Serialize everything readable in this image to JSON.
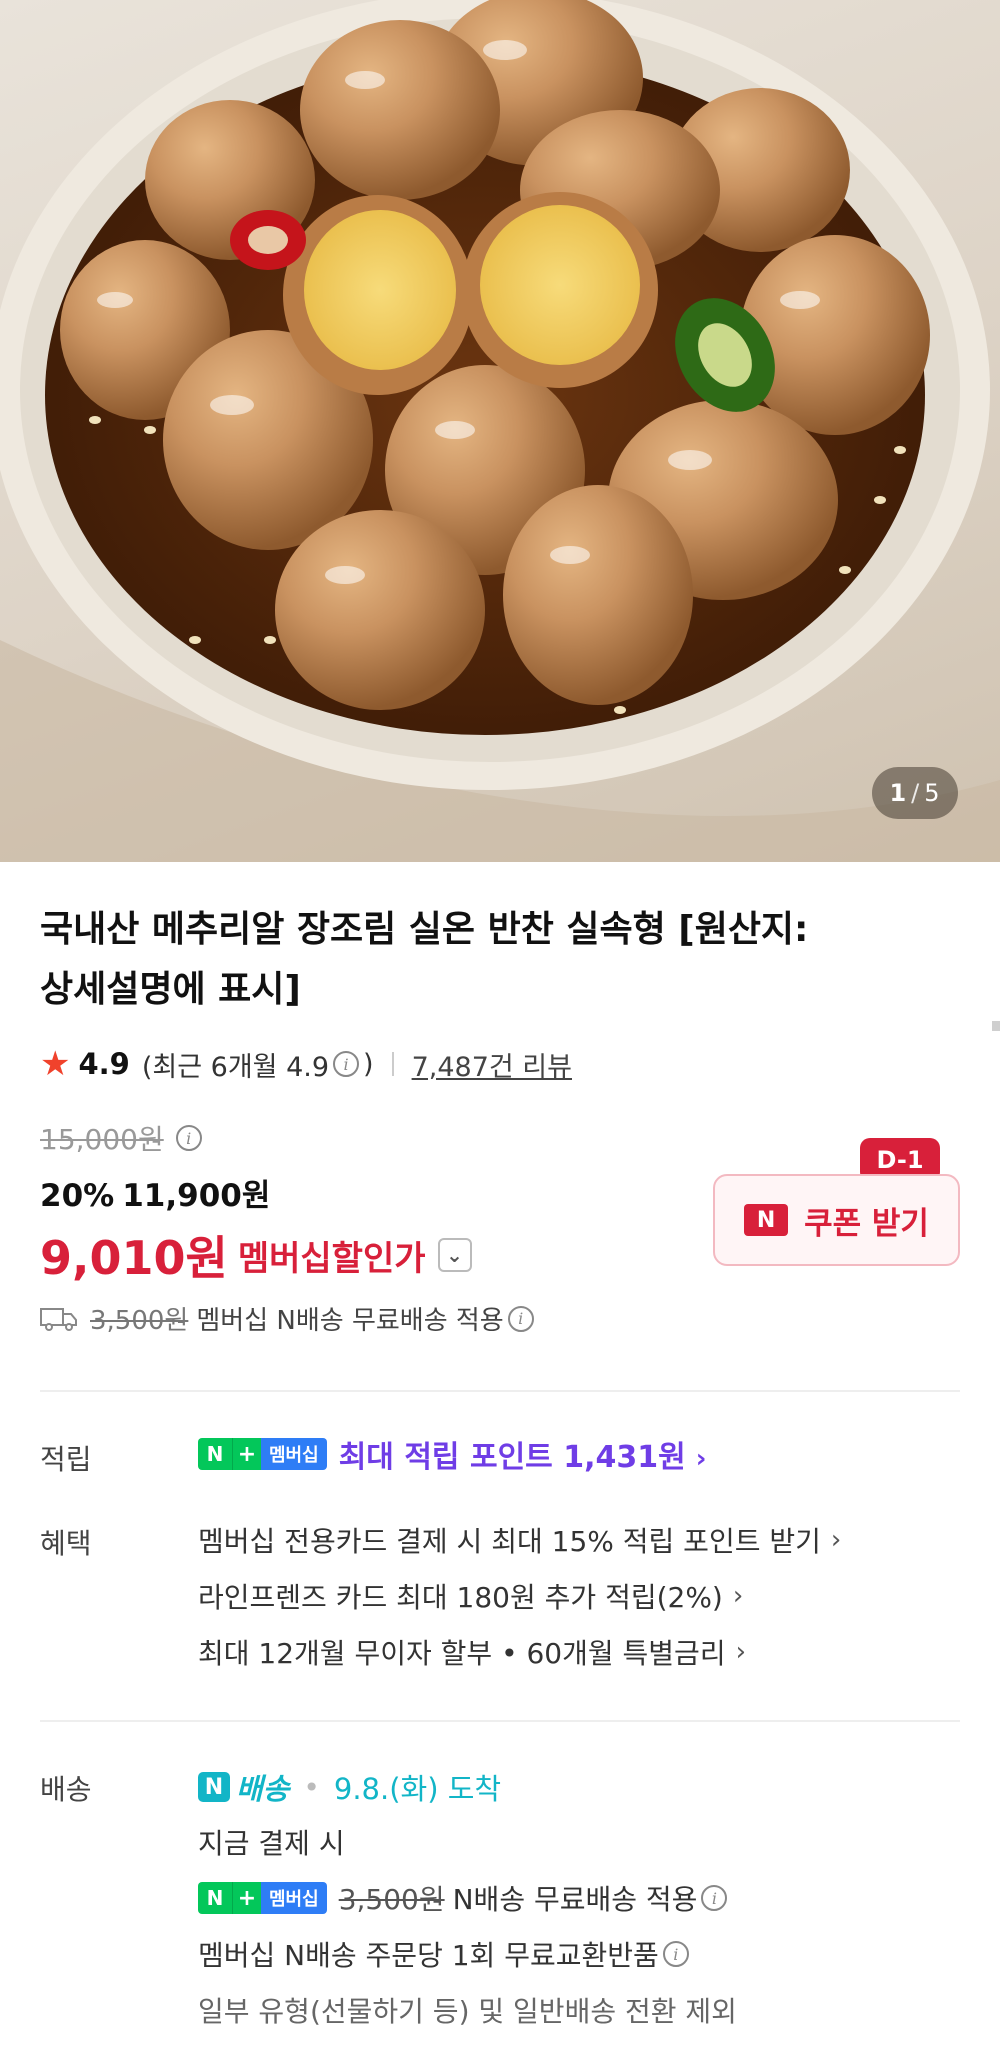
{
  "image_counter": {
    "current": "1",
    "separator": "/",
    "total": "5"
  },
  "product": {
    "title_line1": "국내산 메추리알 장조림 실온 반찬 실속형 [원산지:",
    "title_line2": "상세설명에 표시]"
  },
  "rating": {
    "score": "4.9",
    "recent_prefix": "(최근 6개월 4.9",
    "recent_suffix": ")",
    "reviews": "7,487건 리뷰"
  },
  "price": {
    "original": "15,000원",
    "discount_rate": "20%",
    "sale_price": "11,900원",
    "member_price": "9,010원",
    "member_label": "멤버십할인가"
  },
  "coupon": {
    "badge": "D-1",
    "n_mark": "N",
    "label": "쿠폰 받기"
  },
  "shipping_summary": {
    "fee": "3,500원",
    "text": "멤버십 N배송 무료배송 적용"
  },
  "points": {
    "label": "적립",
    "badge_n": "N",
    "badge_plus": "+",
    "badge_membership": "멤버십",
    "text": "최대 적립 포인트 1,431원"
  },
  "benefits": {
    "label": "혜택",
    "items": [
      "멤버십 전용카드 결제 시 최대 15% 적립 포인트 받기",
      "라인프렌즈 카드 최대 180원 추가 적립(2%)",
      "최대 12개월 무이자 할부 • 60개월 특별금리"
    ]
  },
  "delivery": {
    "label": "배송",
    "service_n": "N",
    "service": "배송",
    "arrival": "9.8.(화) 도착",
    "condition": "지금 결제 시",
    "fee": "3,500원",
    "free_text": "N배송 무료배송 적용",
    "exchange": "멤버십 N배송 주문당 1회 무료교환반품",
    "exclusion": "일부 유형(선물하기 등) 및 일반배송 전환 제외"
  },
  "colors": {
    "accent_red": "#d8203a",
    "naver_green": "#03c75a",
    "point_purple": "#6f3de6",
    "delivery_teal": "#12b5c7"
  },
  "icons": [
    "star-icon",
    "info-icon",
    "chevron-down-icon",
    "truck-icon",
    "chevron-right-icon"
  ]
}
